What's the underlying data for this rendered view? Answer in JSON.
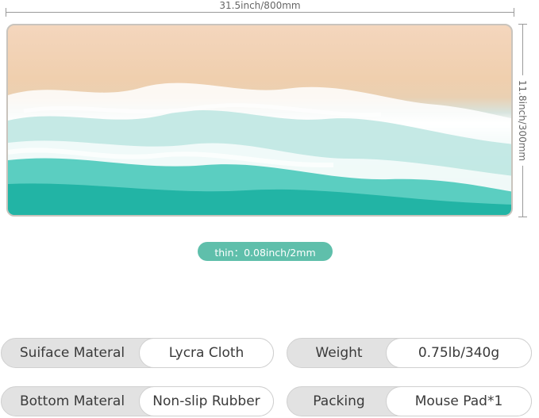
{
  "dimensions": {
    "width_label": "31.5inch/800mm",
    "height_label": "11.8inch/300mm",
    "thickness_label": "thin：0.08inch/2mm"
  },
  "specs": [
    {
      "key": "Suiface Materal",
      "value": "Lycra Cloth"
    },
    {
      "key": "Weight",
      "value": "0.75lb/340g"
    },
    {
      "key": "Bottom Materal",
      "value": "Non-slip Rubber"
    },
    {
      "key": "Packing",
      "value": "Mouse Pad*1"
    }
  ],
  "colors": {
    "accent": "#5fbfab",
    "sand": "#f0cfae",
    "sea": "#1fb3a4",
    "spec_key_bg": "#e2e2e2"
  },
  "image": {
    "subject": "beach-waves-mousepad"
  }
}
